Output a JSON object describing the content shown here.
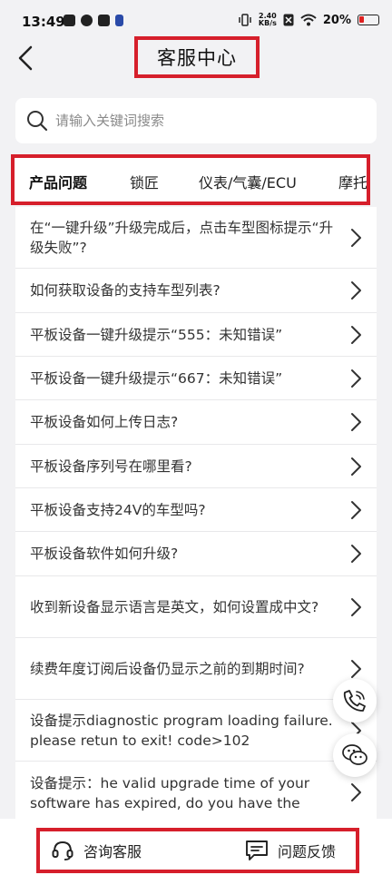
{
  "status_bar": {
    "time": "13:49",
    "speed_value": "2.40",
    "speed_unit": "KB/s",
    "battery": "20%"
  },
  "header": {
    "title": "客服中心",
    "back_icon": "chevron-left-icon"
  },
  "search": {
    "placeholder": "请输入关键词搜索",
    "value": ""
  },
  "tabs": [
    {
      "label": "产品问题",
      "active": true
    },
    {
      "label": "锁匠",
      "active": false
    },
    {
      "label": "仪表/气囊/ECU",
      "active": false
    },
    {
      "label": "摩托车",
      "active": false
    }
  ],
  "faq": [
    {
      "q": "在“一键升级”升级完成后，点击车型图标提示“升级失败”?"
    },
    {
      "q": "如何获取设备的支持车型列表?"
    },
    {
      "q": "平板设备一键升级提示“555：未知错误”"
    },
    {
      "q": "平板设备一键升级提示“667：未知错误”"
    },
    {
      "q": "平板设备如何上传日志?"
    },
    {
      "q": "平板设备序列号在哪里看?"
    },
    {
      "q": "平板设备支持24V的车型吗?"
    },
    {
      "q": "平板设备软件如何升级?"
    },
    {
      "q": "收到新设备显示语言是英文，如何设置成中文?"
    },
    {
      "q": "续费年度订阅后设备仍显示之前的到期时间?"
    },
    {
      "q": "设备提示diagnostic program loading failure. please retun to exit! code>102"
    },
    {
      "q": "设备提示：he valid upgrade time of your software has expired, do you have the"
    }
  ],
  "floating": {
    "phone_icon": "phone-icon",
    "chat_icon": "wechat-icon"
  },
  "bottom": {
    "consult_label": "咨询客服",
    "feedback_label": "问题反馈"
  },
  "colors": {
    "highlight": "#d61f2b",
    "background": "#f2f2f4"
  }
}
